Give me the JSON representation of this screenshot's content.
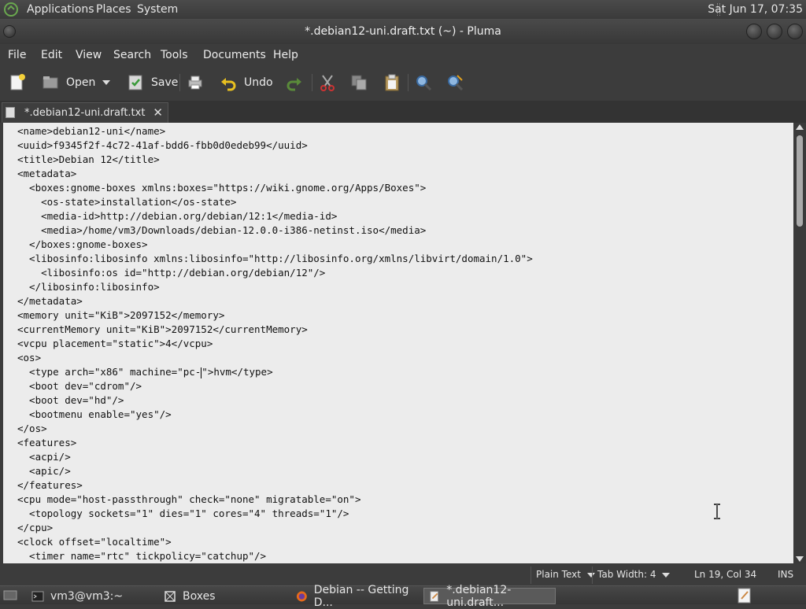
{
  "top_panel": {
    "menus": [
      "Applications",
      "Places",
      "System"
    ],
    "clock": "Sat Jun 17, 07:35"
  },
  "window": {
    "title": "*.debian12-uni.draft.txt (~) - Pluma"
  },
  "menubar": [
    "File",
    "Edit",
    "View",
    "Search",
    "Tools",
    "Documents",
    "Help"
  ],
  "toolbar": {
    "open_label": "Open",
    "save_label": "Save",
    "undo_label": "Undo"
  },
  "tab": {
    "label": "*.debian12-uni.draft.txt"
  },
  "editor": {
    "lines": [
      "<name>debian12-uni</name>",
      "<uuid>f9345f2f-4c72-41af-bdd6-fbb0d0edeb99</uuid>",
      "<title>Debian 12</title>",
      "<metadata>",
      "  <boxes:gnome-boxes xmlns:boxes=\"https://wiki.gnome.org/Apps/Boxes\">",
      "    <os-state>installation</os-state>",
      "    <media-id>http://debian.org/debian/12:1</media-id>",
      "    <media>/home/vm3/Downloads/debian-12.0.0-i386-netinst.iso</media>",
      "  </boxes:gnome-boxes>",
      "  <libosinfo:libosinfo xmlns:libosinfo=\"http://libosinfo.org/xmlns/libvirt/domain/1.0\">",
      "    <libosinfo:os id=\"http://debian.org/debian/12\"/>",
      "  </libosinfo:libosinfo>",
      "</metadata>",
      "<memory unit=\"KiB\">2097152</memory>",
      "<currentMemory unit=\"KiB\">2097152</currentMemory>",
      "<vcpu placement=\"static\">4</vcpu>",
      "<os>",
      "  <type arch=\"x86\" machine=\"pc-",
      "  <boot dev=\"cdrom\"/>",
      "  <boot dev=\"hd\"/>",
      "  <bootmenu enable=\"yes\"/>",
      "</os>",
      "<features>",
      "  <acpi/>",
      "  <apic/>",
      "</features>",
      "<cpu mode=\"host-passthrough\" check=\"none\" migratable=\"on\">",
      "  <topology sockets=\"1\" dies=\"1\" cores=\"4\" threads=\"1\"/>",
      "</cpu>",
      "<clock offset=\"localtime\">",
      "  <timer name=\"rtc\" tickpolicy=\"catchup\"/>"
    ],
    "caret_line_tail": "\">hvm</type>"
  },
  "statusbar": {
    "language": "Plain Text",
    "tab_width": "Tab Width:  4",
    "position": "Ln 19, Col 34",
    "mode": "INS"
  },
  "taskbar": {
    "items": [
      "vm3@vm3:~",
      "Boxes",
      "Debian -- Getting D...",
      "*.debian12-uni.draft..."
    ]
  },
  "colors": {
    "panel_bg": "#3c3c3c",
    "editor_bg": "#ececec",
    "text": "#111111"
  }
}
